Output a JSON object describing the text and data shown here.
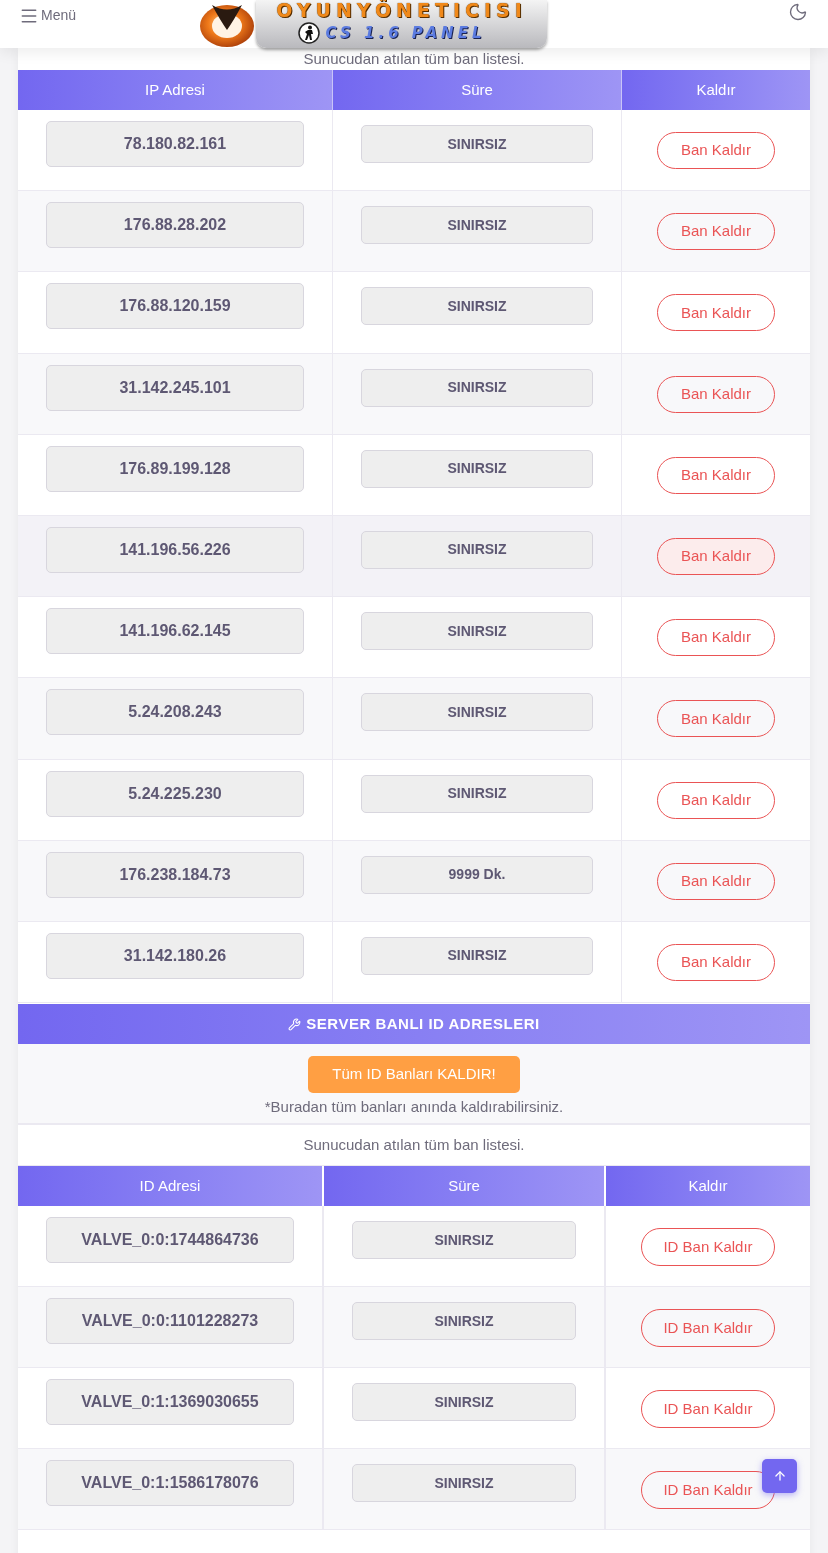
{
  "header": {
    "menu_label": "Menü",
    "logo": {
      "title": "OYUNYÖNETICISI",
      "subtitle": "CS 1.6 PANEL"
    }
  },
  "ip_bans": {
    "caption": "Sunucudan atılan tüm ban listesi.",
    "columns": [
      "IP Adresi",
      "Süre",
      "Kaldır"
    ],
    "rows": [
      {
        "ip": "78.180.82.161",
        "duration": "SINIRSIZ",
        "action": "Ban Kaldır",
        "hovered": false
      },
      {
        "ip": "176.88.28.202",
        "duration": "SINIRSIZ",
        "action": "Ban Kaldır",
        "hovered": false
      },
      {
        "ip": "176.88.120.159",
        "duration": "SINIRSIZ",
        "action": "Ban Kaldır",
        "hovered": false
      },
      {
        "ip": "31.142.245.101",
        "duration": "SINIRSIZ",
        "action": "Ban Kaldır",
        "hovered": false
      },
      {
        "ip": "176.89.199.128",
        "duration": "SINIRSIZ",
        "action": "Ban Kaldır",
        "hovered": false
      },
      {
        "ip": "141.196.56.226",
        "duration": "SINIRSIZ",
        "action": "Ban Kaldır",
        "hovered": true
      },
      {
        "ip": "141.196.62.145",
        "duration": "SINIRSIZ",
        "action": "Ban Kaldır",
        "hovered": false
      },
      {
        "ip": "5.24.208.243",
        "duration": "SINIRSIZ",
        "action": "Ban Kaldır",
        "hovered": false
      },
      {
        "ip": "5.24.225.230",
        "duration": "SINIRSIZ",
        "action": "Ban Kaldır",
        "hovered": false
      },
      {
        "ip": "176.238.184.73",
        "duration": "9999 Dk.",
        "action": "Ban Kaldır",
        "hovered": false
      },
      {
        "ip": "31.142.180.26",
        "duration": "SINIRSIZ",
        "action": "Ban Kaldır",
        "hovered": false
      }
    ]
  },
  "id_bans": {
    "title": "SERVER BANLI ID ADRESLERI",
    "remove_all_button": "Tüm ID Banları KALDIR!",
    "note": "*Buradan tüm banları anında kaldırabilirsiniz.",
    "caption": "Sunucudan atılan tüm ban listesi.",
    "columns": [
      "ID Adresi",
      "Süre",
      "Kaldır"
    ],
    "rows": [
      {
        "id": "VALVE_0:0:1744864736",
        "duration": "SINIRSIZ",
        "action": "ID Ban Kaldır"
      },
      {
        "id": "VALVE_0:0:1101228273",
        "duration": "SINIRSIZ",
        "action": "ID Ban Kaldır"
      },
      {
        "id": "VALVE_0:1:1369030655",
        "duration": "SINIRSIZ",
        "action": "ID Ban Kaldır"
      },
      {
        "id": "VALVE_0:1:1586178076",
        "duration": "SINIRSIZ",
        "action": "ID Ban Kaldır"
      }
    ]
  }
}
